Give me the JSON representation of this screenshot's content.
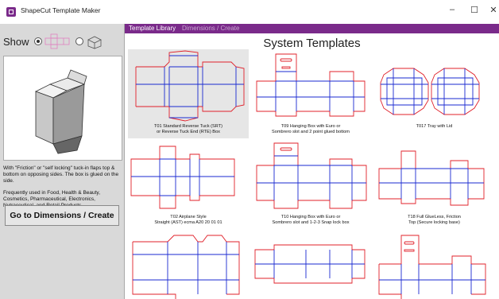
{
  "window": {
    "title": "ShapeCut Template Maker",
    "controls": {
      "minimize": "–",
      "maximize": "☐",
      "close": "✕"
    }
  },
  "left_panel": {
    "show_label": "Show",
    "view_options": [
      "flat-template-view",
      "3d-box-view"
    ],
    "selected_view": "flat-template-view",
    "description": [
      "With \"Friction\" or \"self locking\" tuck-in flaps top & bottom on opposing sides. The box is glued on the side.",
      "Frequently used in Food, Health & Beauty, Cosmetics, Pharmaceutical, Electronics, Nutraceutical, and Retail Products."
    ],
    "go_button": "Go to Dimensions / Create"
  },
  "tabs": [
    {
      "label": "Template Library",
      "active": true
    },
    {
      "label": "Dimensions / Create",
      "active": false
    }
  ],
  "main": {
    "title": "System Templates",
    "templates": [
      {
        "label_lines": [
          "T01 Standard Reverse Tuck (SRT)",
          "or Reverse Tuck End (RTE) Box"
        ],
        "selected": true
      },
      {
        "label_lines": [
          "T09 Hanging Box with Euro or",
          "Sombrero slot and 2 point glued bottom"
        ],
        "selected": false
      },
      {
        "label_lines": [
          "T017 Tray with Lid"
        ],
        "selected": false
      },
      {
        "label_lines": [
          "T02 Airplane Style",
          "Straight (AST) ecma A20 20 01 01"
        ],
        "selected": false
      },
      {
        "label_lines": [
          "T10 Hanging Box with Euro or",
          "Sombrero slot and 1-2-3 Snap lock box"
        ],
        "selected": false
      },
      {
        "label_lines": [
          "T18 Full GlueLess, Friction",
          "Top (Secure locking base)"
        ],
        "selected": false
      },
      {
        "label_lines": [],
        "selected": false
      },
      {
        "label_lines": [],
        "selected": false
      },
      {
        "label_lines": [],
        "selected": false
      }
    ]
  },
  "colors": {
    "accent": "#7a2a8a",
    "cut_line": "#e0202a",
    "fold_line": "#1a2ad0",
    "panel": "#d9d9d9"
  }
}
